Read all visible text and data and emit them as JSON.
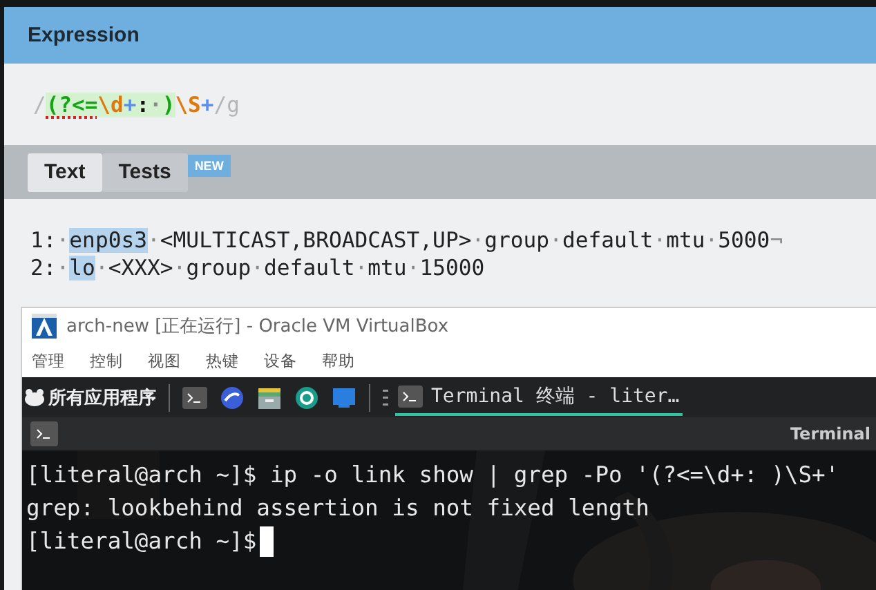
{
  "expression_panel": {
    "title": "Expression",
    "tokens": [
      {
        "text": "/",
        "kind": "delim",
        "in_group": false,
        "error": false
      },
      {
        "text": "(?<=",
        "kind": "group",
        "in_group": true,
        "error": true
      },
      {
        "text": "\\d",
        "kind": "escape",
        "in_group": true,
        "error": false
      },
      {
        "text": "+",
        "kind": "quant",
        "in_group": true,
        "error": false
      },
      {
        "text": ":",
        "kind": "literal",
        "in_group": true,
        "error": false
      },
      {
        "text": "·",
        "kind": "space",
        "in_group": true,
        "error": false
      },
      {
        "text": ")",
        "kind": "group",
        "in_group": true,
        "error": false
      },
      {
        "text": "\\S",
        "kind": "escape",
        "in_group": false,
        "error": false
      },
      {
        "text": "+",
        "kind": "quant",
        "in_group": false,
        "error": false
      },
      {
        "text": "/g",
        "kind": "delim",
        "in_group": false,
        "error": false
      }
    ]
  },
  "tabs": [
    {
      "label": "Text",
      "selected": true
    },
    {
      "label": "Tests",
      "selected": false,
      "badge": "NEW"
    }
  ],
  "text_lines": [
    [
      {
        "text": "1:",
        "kind": "text"
      },
      {
        "text": "·",
        "kind": "space"
      },
      {
        "text": "enp0s3",
        "kind": "match"
      },
      {
        "text": "·",
        "kind": "space"
      },
      {
        "text": "<MULTICAST,BROADCAST,UP>",
        "kind": "text"
      },
      {
        "text": "·",
        "kind": "space"
      },
      {
        "text": "group",
        "kind": "text"
      },
      {
        "text": "·",
        "kind": "space"
      },
      {
        "text": "default",
        "kind": "text"
      },
      {
        "text": "·",
        "kind": "space"
      },
      {
        "text": "mtu",
        "kind": "text"
      },
      {
        "text": "·",
        "kind": "space"
      },
      {
        "text": "5000",
        "kind": "text"
      },
      {
        "text": "¬",
        "kind": "space"
      }
    ],
    [
      {
        "text": "2:",
        "kind": "text"
      },
      {
        "text": "·",
        "kind": "space"
      },
      {
        "text": "lo",
        "kind": "match"
      },
      {
        "text": "·",
        "kind": "space"
      },
      {
        "text": "<XXX>",
        "kind": "text"
      },
      {
        "text": "·",
        "kind": "space"
      },
      {
        "text": "group",
        "kind": "text"
      },
      {
        "text": "·",
        "kind": "space"
      },
      {
        "text": "default",
        "kind": "text"
      },
      {
        "text": "·",
        "kind": "space"
      },
      {
        "text": "mtu",
        "kind": "text"
      },
      {
        "text": "·",
        "kind": "space"
      },
      {
        "text": "15000",
        "kind": "text"
      }
    ]
  ],
  "vm_window": {
    "title": "arch-new [正在运行] - Oracle VM VirtualBox",
    "menu": [
      "管理",
      "控制",
      "视图",
      "热键",
      "设备",
      "帮助"
    ],
    "taskbar": {
      "menu_label": "所有应用程序",
      "launchers": [
        {
          "kind": "terminal"
        },
        {
          "kind": "browser"
        },
        {
          "kind": "files"
        },
        {
          "kind": "camera"
        },
        {
          "kind": "screen"
        }
      ],
      "tasks": [
        {
          "label": "Terminal 终端 - liter…",
          "selected": true
        }
      ]
    },
    "terminal": {
      "title": "Terminal",
      "lines": [
        "[literal@arch ~]$ ip -o link show | grep -Po '(?<=\\d+: )\\S+'",
        "grep: lookbehind assertion is not fixed length",
        "[literal@arch ~]$"
      ]
    }
  }
}
